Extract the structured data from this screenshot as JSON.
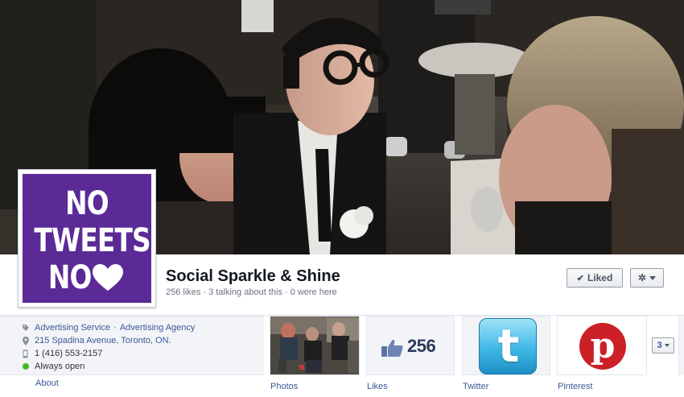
{
  "page": {
    "name": "Social Sparkle & Shine",
    "stats": "256 likes · 3 talking about this · 0 were here",
    "profile_text": [
      "NO",
      "TWEETS",
      "NO"
    ],
    "profile_color": "#5b2a96"
  },
  "actions": {
    "liked_label": "Liked",
    "settings_icon": "gear-icon"
  },
  "about": {
    "category_1": "Advertising Service",
    "category_separator": "·",
    "category_2": "Advertising Agency",
    "address": "215 Spadina Avenue, Toronto, ON.",
    "phone": "1 (416) 553-2157",
    "hours": "Always open",
    "about_link": "About"
  },
  "apps": [
    {
      "label": "Photos",
      "icon": "photo-thumbnail"
    },
    {
      "label": "Likes",
      "icon": "thumbs-up-icon",
      "count": "256"
    },
    {
      "label": "Twitter",
      "icon": "twitter-icon"
    },
    {
      "label": "Pinterest",
      "icon": "pinterest-icon"
    }
  ],
  "more_apps_count": "3",
  "colors": {
    "link": "#3b5998",
    "open_status": "#42b72a",
    "pinterest": "#cb2027",
    "twitter": "#3fb8e6"
  }
}
